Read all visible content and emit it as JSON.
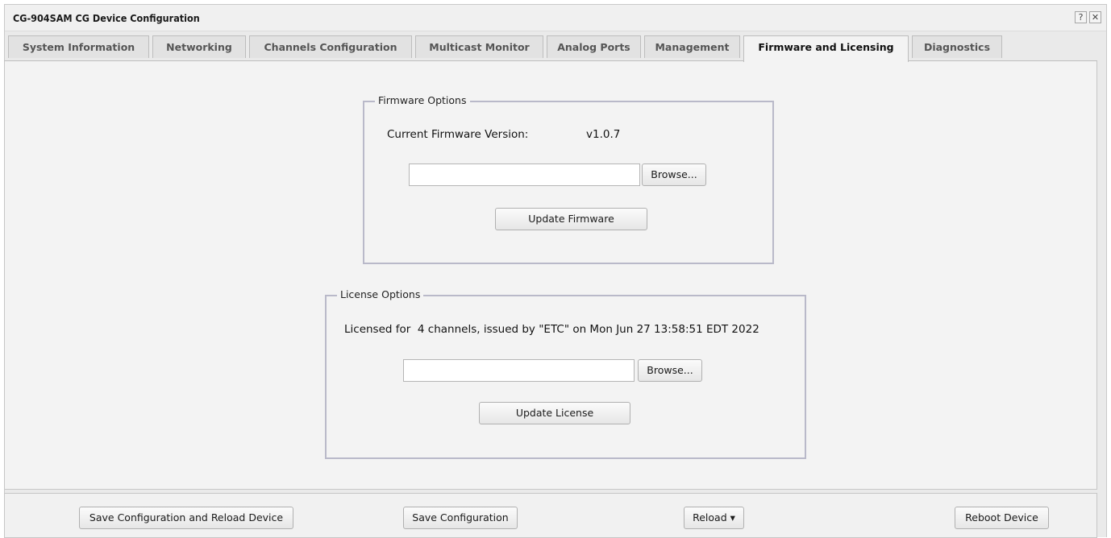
{
  "window": {
    "title": "CG-904SAM CG Device Configuration",
    "help_icon_glyph": "?",
    "close_icon_glyph": "✕"
  },
  "tabs": [
    {
      "label": "System Information"
    },
    {
      "label": "Networking"
    },
    {
      "label": "Channels Configuration"
    },
    {
      "label": "Multicast Monitor"
    },
    {
      "label": "Analog Ports"
    },
    {
      "label": "Management"
    },
    {
      "label": "Firmware and Licensing",
      "active": true
    },
    {
      "label": "Diagnostics"
    }
  ],
  "firmware": {
    "legend": "Firmware Options",
    "current_label": "Current Firmware Version:",
    "current_value": "v1.0.7",
    "file_value": "",
    "browse_label": "Browse...",
    "update_label": "Update Firmware"
  },
  "license": {
    "legend": "License Options",
    "info": "Licensed for  4 channels, issued by \"ETC\" on Mon Jun 27 13:58:51 EDT 2022",
    "file_value": "",
    "browse_label": "Browse...",
    "update_label": "Update License"
  },
  "footer": {
    "save_reload_label": "Save Configuration and Reload Device",
    "save_label": "Save Configuration",
    "reload_label": "Reload ▾",
    "reboot_label": "Reboot Device"
  },
  "colors": {
    "fieldset_border": "#b9b9c9",
    "panel_bg": "#f3f3f3",
    "tab_bg": "#e2e2e2"
  }
}
